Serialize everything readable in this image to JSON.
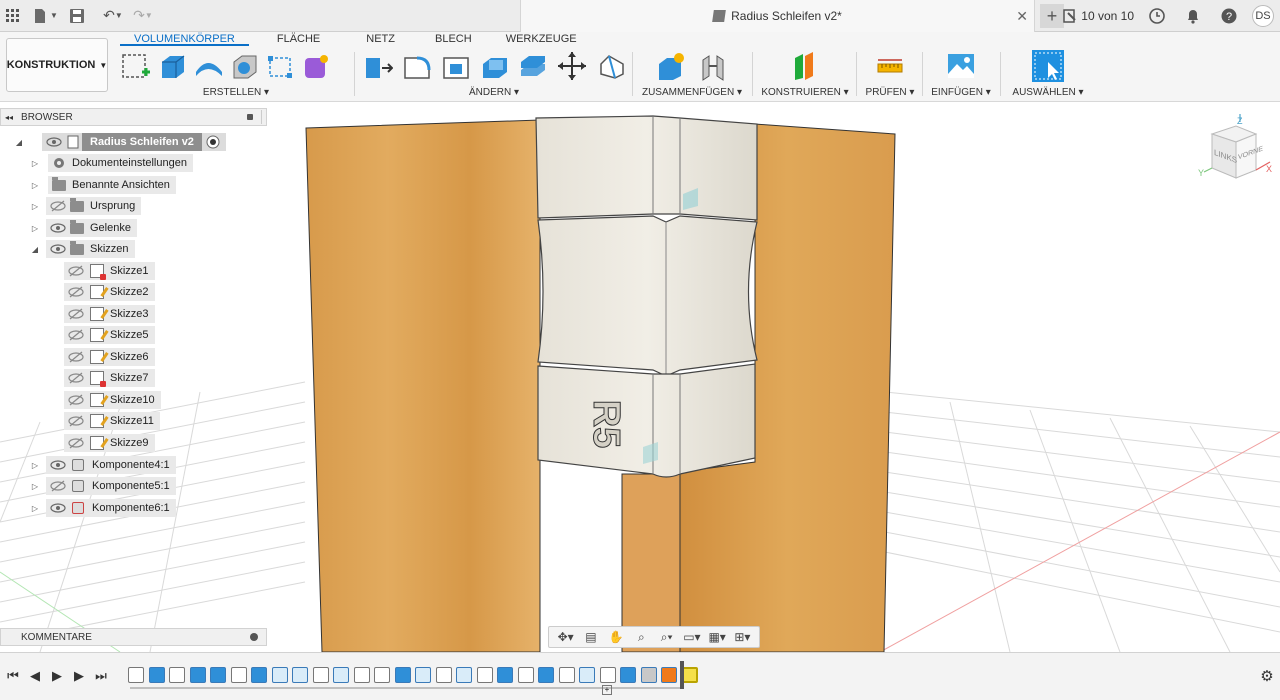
{
  "window": {
    "document_title": "Radius Schleifen v2*",
    "jobs_status": "10 von 10",
    "user_initials": "DS",
    "icons": [
      "apps-grid-icon",
      "file-icon",
      "save-icon",
      "undo-icon",
      "redo-icon",
      "close-icon",
      "new-tab-icon",
      "clock-icon",
      "bell-icon",
      "help-icon"
    ]
  },
  "ribbon": {
    "workspace_label": "KONSTRUKTION",
    "tabs": [
      "VOLUMENKÖRPER",
      "FLÄCHE",
      "NETZ",
      "BLECH",
      "WERKZEUGE"
    ],
    "active_tab": "VOLUMENKÖRPER",
    "groups": {
      "erstellen": "ERSTELLEN",
      "aendern": "ÄNDERN",
      "zusammenfuegen": "ZUSAMMENFÜGEN",
      "konstruieren": "KONSTRUIEREN",
      "pruefen": "PRÜFEN",
      "einfuegen": "EINFÜGEN",
      "auswaehlen": "AUSWÄHLEN"
    },
    "accent_color": "#0a6fc7"
  },
  "browser": {
    "title": "BROWSER",
    "root": "Radius Schleifen v2",
    "items": {
      "dokumenteinstellungen": "Dokumenteinstellungen",
      "benannte_ansichten": "Benannte Ansichten",
      "ursprung": "Ursprung",
      "gelenke": "Gelenke",
      "skizzen": "Skizzen"
    },
    "sketches": [
      "Skizze1",
      "Skizze2",
      "Skizze3",
      "Skizze5",
      "Skizze6",
      "Skizze7",
      "Skizze10",
      "Skizze11",
      "Skizze9"
    ],
    "components": [
      "Komponente4:1",
      "Komponente5:1",
      "Komponente6:1"
    ]
  },
  "comments": {
    "title": "KOMMENTARE"
  },
  "viewcube": {
    "left_face": "LINKS",
    "front_face": "VORNE",
    "axis_z": "Z",
    "axis_x": "X",
    "axis_y": "Y"
  },
  "model": {
    "embossed_text": "R5"
  }
}
